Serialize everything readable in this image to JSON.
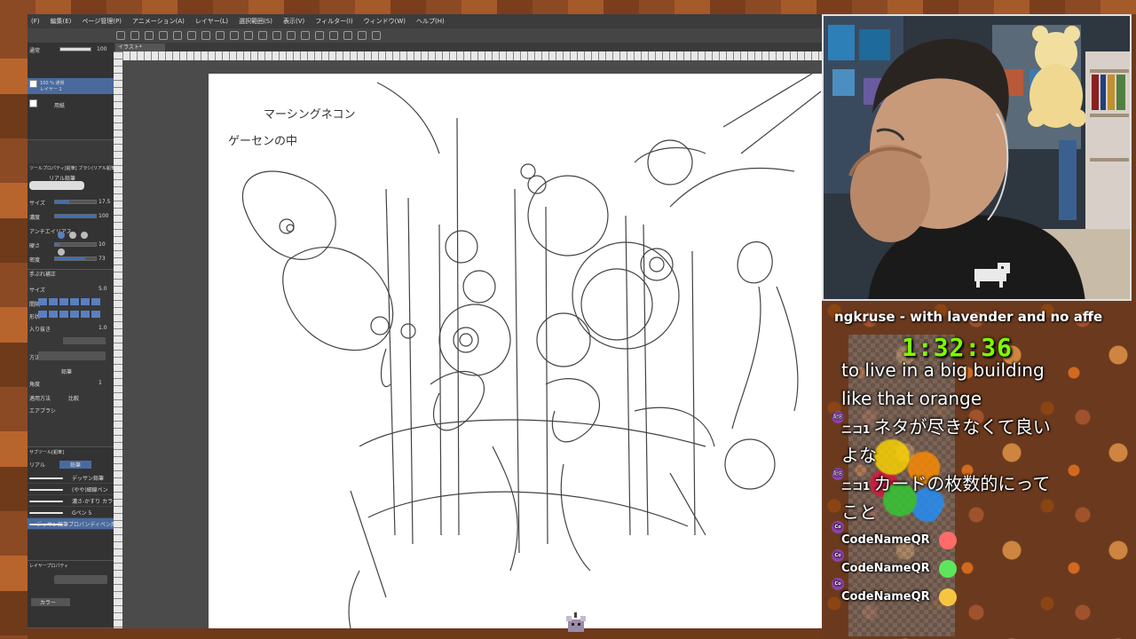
{
  "menu": [
    "(F)",
    "編集(E)",
    "ページ管理(P)",
    "アニメーション(A)",
    "レイヤー(L)",
    "選択範囲(S)",
    "表示(V)",
    "フィルター(I)",
    "ウィンドウ(W)",
    "ヘルプ(H)"
  ],
  "canvas": {
    "tab_label": "イラスト*"
  },
  "layers": {
    "blend_mode": "通常",
    "opacity": "100",
    "items": [
      {
        "label": "100 % 通常\nレイヤー 1"
      },
      {
        "label": "用紙"
      }
    ]
  },
  "tool_property": {
    "header": "ツールプロパティ[鉛筆] ブラシ(リアル鉛筆)",
    "brush_label": "リアル鉛筆",
    "rows": [
      {
        "label": "サイズ",
        "value": "17.5"
      },
      {
        "label": "濃度",
        "value": "100"
      },
      {
        "label": "アンチエイリアス",
        "value": ""
      },
      {
        "label": "硬さ",
        "value": "10"
      },
      {
        "label": "密度",
        "value": "73"
      }
    ]
  },
  "sub_tool_detail": {
    "rows": [
      {
        "label": "手ぶれ補正",
        "value": ""
      },
      {
        "label": "サイズ",
        "value": "5.0"
      },
      {
        "label": "間隔",
        "value": ""
      },
      {
        "label": "形状",
        "value": ""
      },
      {
        "label": "入り抜き",
        "value": "1.0"
      },
      {
        "label": "方法",
        "value": ""
      },
      {
        "label": "鉛筆",
        "value": ""
      },
      {
        "label": "角度",
        "value": "1"
      },
      {
        "label": "適用方法",
        "value": "比較"
      },
      {
        "label": "エアブラシ",
        "value": ""
      }
    ]
  },
  "sub_tool": {
    "header": "サブツール[鉛筆]",
    "tabs": [
      "リアル",
      "鉛筆"
    ],
    "brushes": [
      "デッサン鉛筆",
      "(やや)細線ペン",
      "濃さ-かすり カラー",
      "Gペン 5",
      "デッサン鉛筆プロバンディペン用"
    ]
  },
  "layer_property": {
    "header": "レイヤープロパティ",
    "color_label": "カラー"
  },
  "canvas_annotations": [
    "マーシングネコン",
    "ゲーセンの中"
  ],
  "stream": {
    "ticker": "ngkruse - with lavender and no affe",
    "timer": "1:32:36"
  },
  "chat": [
    {
      "user": "",
      "text": "to live in a big building"
    },
    {
      "user": "",
      "text": "like that orange"
    },
    {
      "user": "ニコ1",
      "text": "ネタが尽きなくて良い"
    },
    {
      "user": "",
      "text": "よな"
    },
    {
      "user": "ニコ1",
      "text": "カードの枚数的にって"
    },
    {
      "user": "",
      "text": "こと"
    },
    {
      "user": "CodeNameQR",
      "text": "",
      "emote": "smile-emote",
      "emote_color": "#ff6b6b"
    },
    {
      "user": "CodeNameQR",
      "text": "",
      "emote": "grin-emote",
      "emote_color": "#5ce65c"
    },
    {
      "user": "CodeNameQR",
      "text": "",
      "emote": "thumbs-up-emote",
      "emote_color": "#f5c542"
    }
  ],
  "chat_badges": [
    "配信",
    "配信",
    "Co",
    "Co",
    "Co"
  ]
}
